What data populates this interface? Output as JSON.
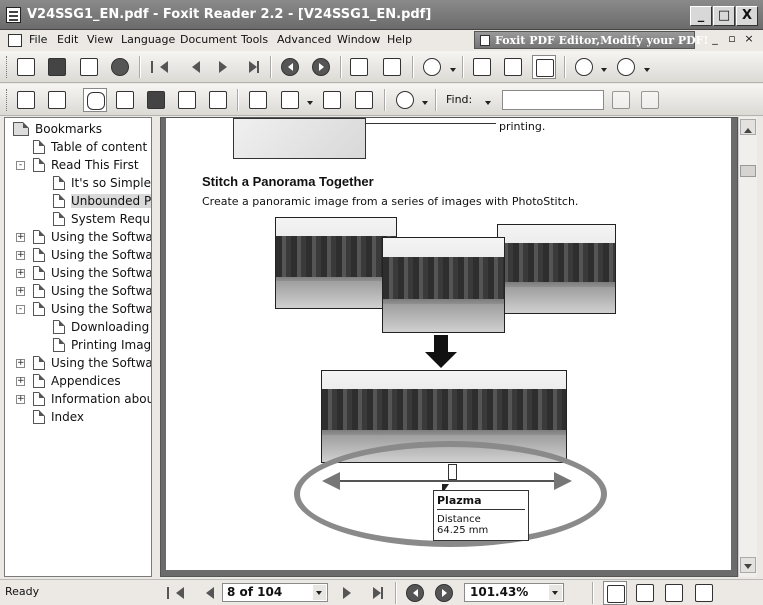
{
  "window": {
    "title": "V24SSG1_EN.pdf - Foxit Reader 2.2 - [V24SSG1_EN.pdf]",
    "buttons": [
      "_",
      "□",
      "X"
    ]
  },
  "menu": [
    "File",
    "Edit",
    "View",
    "Language",
    "Document",
    "Tools",
    "Advanced",
    "Window",
    "Help"
  ],
  "ad_text": "Foxit PDF Editor,Modify your PDF!",
  "mdi_buttons": [
    "_",
    "▫",
    "×"
  ],
  "toolbar2": {
    "find_label": "Find:",
    "find_value": ""
  },
  "bookmarks": [
    {
      "label": "Bookmarks",
      "level": 0,
      "expand": ""
    },
    {
      "label": "Table of content",
      "level": 1,
      "expand": ""
    },
    {
      "label": "Read This First",
      "level": 1,
      "expand": "-"
    },
    {
      "label": "It's so Simple!",
      "level": 2,
      "expand": ""
    },
    {
      "label": "Unbounded P",
      "level": 2,
      "expand": "",
      "selected": true
    },
    {
      "label": "System Requi",
      "level": 2,
      "expand": ""
    },
    {
      "label": "Using the Softwa",
      "level": 1,
      "expand": "+"
    },
    {
      "label": "Using the Softwa",
      "level": 1,
      "expand": "+"
    },
    {
      "label": "Using the Softwa",
      "level": 1,
      "expand": "+"
    },
    {
      "label": "Using the Softwa",
      "level": 1,
      "expand": "+"
    },
    {
      "label": "Using the Softwa",
      "level": 1,
      "expand": "-"
    },
    {
      "label": "Downloading",
      "level": 2,
      "expand": ""
    },
    {
      "label": "Printing Image",
      "level": 2,
      "expand": ""
    },
    {
      "label": "Using the Softwa",
      "level": 1,
      "expand": "+"
    },
    {
      "label": "Appendices",
      "level": 1,
      "expand": "+"
    },
    {
      "label": "Information abou",
      "level": 1,
      "expand": "+"
    },
    {
      "label": "Index",
      "level": 1,
      "expand": ""
    }
  ],
  "document": {
    "top_text": "printing.",
    "heading": "Stitch a Panorama Together",
    "subtitle": "Create a panoramic image from a series of images with PhotoStitch.",
    "tooltip_title": "Plazma",
    "tooltip_label": "Distance",
    "tooltip_value": "64.25 mm"
  },
  "status": {
    "text": "Ready",
    "page": "8 of 104",
    "zoom": "101.43%"
  }
}
